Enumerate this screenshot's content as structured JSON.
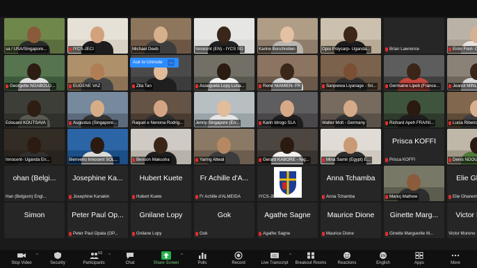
{
  "tiles": [
    {
      "name": "sa / USA/Singapore...",
      "muted": false,
      "kind": "video",
      "bg": "#5b6f3e",
      "skin": "#8a5b3a",
      "shirt": "#2a2a2a",
      "wall": "#7f9b55"
    },
    {
      "name": "IYCS-JECI",
      "muted": true,
      "kind": "video",
      "bg": "#d8d2c6",
      "skin": "#d2a27c",
      "shirt": "#1d1d1d",
      "wall": "#f0ece4"
    },
    {
      "name": "Michael Deeb",
      "muted": false,
      "kind": "video",
      "bg": "#6d5744",
      "skin": "#d4b08d",
      "shirt": "#3d3d3d",
      "wall": "#a8906f"
    },
    {
      "name": "Innocent (EN) - IYCS SG",
      "muted": false,
      "kind": "video",
      "active": true,
      "bg": "#d9d9d7",
      "skin": "#3a2618",
      "shirt": "#222",
      "wall": "#f0f0ee"
    },
    {
      "name": "Karine Bonchretien",
      "muted": false,
      "kind": "video",
      "bg": "#8e7d6a",
      "skin": "#e3c1a2",
      "shirt": "#b9b6b0",
      "wall": "#cbb89c"
    },
    {
      "name": "Opio Polycarp- Uganda...",
      "muted": false,
      "kind": "video",
      "bg": "#b8aa94",
      "skin": "#3b2618",
      "shirt": "#1c1c1c",
      "wall": "#dcd2c2"
    },
    {
      "name": "Brian Lawrence",
      "muted": true,
      "kind": "name",
      "big": ""
    },
    {
      "name": "Eirini Freri- Greece",
      "muted": true,
      "kind": "video",
      "bg": "#a99f93",
      "skin": "#d8b193",
      "shirt": "#e7e2dc",
      "wall": "#c9c1b6"
    },
    {
      "name": "Georgette NGABOLO...",
      "muted": true,
      "kind": "video",
      "bg": "#3d5a3a",
      "skin": "#2d1c12",
      "shirt": "#e0e0e0",
      "wall": "#6b8a5e"
    },
    {
      "name": "EUGENE VAZ",
      "muted": true,
      "kind": "video",
      "bg": "#8c7356",
      "skin": "#b07d55",
      "shirt": "#444",
      "wall": "#caa77c"
    },
    {
      "name": "Zita Tan",
      "muted": true,
      "kind": "video",
      "bg": "#3c3c3c",
      "skin": "#e0bb9a",
      "shirt": "#1f1f1f",
      "wall": "#555"
    },
    {
      "name": "Asseguela Lopy Luna...",
      "muted": true,
      "kind": "video",
      "bg": "#59584f",
      "skin": "#2b1c12",
      "shirt": "#f2f2f2",
      "wall": "#87857a"
    },
    {
      "name": "René NIAMIEN- FR",
      "muted": true,
      "kind": "video",
      "bg": "#6a5848",
      "skin": "#3b2719",
      "shirt": "#d7d7d7",
      "wall": "#a58c75"
    },
    {
      "name": "Sanjeewa Liyanage - Sri...",
      "muted": true,
      "kind": "video",
      "bg": "#5d4b3b",
      "skin": "#7a4f34",
      "shirt": "#2f2f2f",
      "wall": "#94775b"
    },
    {
      "name": "Germaine Lipeb (France...",
      "muted": true,
      "kind": "video",
      "bg": "#3f3f3f",
      "skin": "#3a2518",
      "shirt": "#c4463d",
      "wall": "#777"
    },
    {
      "name": "Jeanot MINLA M...",
      "muted": true,
      "kind": "video",
      "bg": "#6e665d",
      "skin": "#3a2518",
      "shirt": "#d9d9d9",
      "wall": "#a3998d"
    },
    {
      "name": "Edouard KOUTSAVA",
      "muted": false,
      "kind": "video",
      "bg": "#30302c",
      "skin": "#2d1d12",
      "shirt": "#5a5a52",
      "wall": "#4a4a44"
    },
    {
      "name": "Augustus (Singapore...",
      "muted": true,
      "kind": "video",
      "bg": "#5c6b7c",
      "skin": "#d7ad88",
      "shirt": "#333",
      "wall": "#8da2b8"
    },
    {
      "name": "Raquel e Nenona Rodrig...",
      "muted": false,
      "kind": "video",
      "bg": "#4a3c32",
      "skin": "#d4a585",
      "shirt": "#2c2c2c",
      "wall": "#7c6756"
    },
    {
      "name": "Jenny-Singapore (En...",
      "muted": false,
      "kind": "video",
      "bg": "#9aa4a8",
      "skin": "#e1bd9c",
      "shirt": "#e5e5e5",
      "wall": "#cfd6d8"
    },
    {
      "name": "Karin Idrogo SLA",
      "muted": true,
      "kind": "video",
      "bg": "#49474a",
      "skin": "#d6a885",
      "shirt": "#1d1d1d",
      "wall": "#707073"
    },
    {
      "name": "Walter Molt - Germany",
      "muted": false,
      "kind": "video",
      "bg": "#5a5148",
      "skin": "#d5aa88",
      "shirt": "#303030",
      "wall": "#8e8171"
    },
    {
      "name": "Richard Apeh FRA/NI...",
      "muted": true,
      "kind": "video",
      "bg": "#2d3a2c",
      "skin": "#2a1a10",
      "shirt": "#1d1d1d",
      "wall": "#4f6a4a"
    },
    {
      "name": "Lucia Ribeiro de...",
      "muted": true,
      "kind": "video",
      "bg": "#5e4b38",
      "skin": "#d9b08e",
      "shirt": "#3d3d3d",
      "wall": "#9d7f60"
    },
    {
      "name": "Innocent- Uganda En...",
      "muted": false,
      "kind": "video",
      "bg": "#29231e",
      "skin": "#2b1b11",
      "shirt": "#2f2f2f",
      "wall": "#3d342c"
    },
    {
      "name": "Bienvenu Innocent SOL...",
      "muted": false,
      "kind": "video",
      "bg": "#1b4f87",
      "skin": "#2a1a10",
      "shirt": "#d9d9d9",
      "wall": "#3a78c0"
    },
    {
      "name": "Benson Makusha",
      "muted": true,
      "kind": "video",
      "bg": "#b7b2aa",
      "skin": "#3a2517",
      "shirt": "#1d1d1d",
      "wall": "#e4e0d9"
    },
    {
      "name": "Yaring Altwal",
      "muted": true,
      "kind": "video",
      "bg": "#6c5d4e",
      "skin": "#b58863",
      "shirt": "#3c3c3c",
      "wall": "#a38f78"
    },
    {
      "name": "Gerard KABORE - Nig...",
      "muted": true,
      "kind": "video",
      "bg": "#3a3430",
      "skin": "#2a1a10",
      "shirt": "#f0f0f0",
      "wall": "#5c534c"
    },
    {
      "name": "Mina Samir (Egypt) E...",
      "muted": true,
      "kind": "video",
      "bg": "#cfc9c0",
      "skin": "#c99a75",
      "shirt": "#2c2c2c",
      "wall": "#efebe5"
    },
    {
      "name": "Prisca KOFFI",
      "muted": true,
      "kind": "name",
      "big": "Prisca KOFFI"
    },
    {
      "name": "Denis NDOUR FR...",
      "muted": true,
      "kind": "video",
      "bg": "#a09886",
      "skin": "#2a1a10",
      "shirt": "#4f7a3a",
      "wall": "#d8d2c3"
    },
    {
      "name": "Han (Belgium) Engl...",
      "muted": false,
      "kind": "name",
      "big": "ohan (Belgi..."
    },
    {
      "name": "Josephine Kanakin",
      "muted": true,
      "kind": "name",
      "big": "Josephine Ka..."
    },
    {
      "name": "Hubert Kuete",
      "muted": true,
      "kind": "name",
      "big": "Hubert Kuete"
    },
    {
      "name": "Fr Achille d'ALMEIDA",
      "muted": true,
      "kind": "name",
      "big": "Fr Achille d'A..."
    },
    {
      "name": "IYCS-JECI",
      "muted": false,
      "kind": "logo",
      "big": ""
    },
    {
      "name": "Anna Tchamba",
      "muted": true,
      "kind": "name",
      "big": "Anna Tchamba"
    },
    {
      "name": "Manoj Mathew",
      "muted": true,
      "kind": "video",
      "bg": "#5c5c4f",
      "skin": "#8a5c3c",
      "shirt": "#2d2d2d",
      "wall": "#8f8f7a"
    },
    {
      "name": "Elie Ghanem",
      "muted": true,
      "kind": "name",
      "big": "Elie Ghane..."
    },
    {
      "name": "",
      "muted": false,
      "kind": "name",
      "big": "Simon"
    },
    {
      "name": "Peter Paul Opata (OP...",
      "muted": true,
      "kind": "name",
      "big": "Peter Paul Op..."
    },
    {
      "name": "Gnilane Lopy",
      "muted": true,
      "kind": "name",
      "big": "Gnilane Lopy"
    },
    {
      "name": "Gok",
      "muted": true,
      "kind": "name",
      "big": "Gok"
    },
    {
      "name": "Agathe Sagne",
      "muted": true,
      "kind": "name",
      "big": "Agathe Sagne"
    },
    {
      "name": "Maurice Dione",
      "muted": true,
      "kind": "name",
      "big": "Maurice Dione"
    },
    {
      "name": "Ginette Marguerite M...",
      "muted": true,
      "kind": "name",
      "big": "Ginette Marg..."
    },
    {
      "name": "Victor Moreno",
      "muted": false,
      "kind": "name",
      "big": "Victor More..."
    }
  ],
  "overlay": {
    "unmute_label": "Ask to Unmute",
    "more_label": "..."
  },
  "toolbar": [
    {
      "id": "video",
      "label": "Stop Video",
      "icon": "video-camera-icon",
      "caret": true
    },
    {
      "id": "security",
      "label": "Security",
      "icon": "shield-icon",
      "caret": false
    },
    {
      "id": "participants",
      "label": "Participants",
      "icon": "participants-icon",
      "caret": true,
      "count": "53"
    },
    {
      "id": "chat",
      "label": "Chat",
      "icon": "chat-bubble-icon",
      "caret": false
    },
    {
      "id": "share",
      "label": "Share Screen",
      "icon": "share-screen-icon",
      "caret": true
    },
    {
      "id": "polls",
      "label": "Polls",
      "icon": "bar-chart-icon",
      "caret": false
    },
    {
      "id": "record",
      "label": "Record",
      "icon": "record-icon",
      "caret": false
    },
    {
      "id": "transcript",
      "label": "Live Transcript",
      "icon": "cc-icon",
      "caret": true
    },
    {
      "id": "breakout",
      "label": "Breakout Rooms",
      "icon": "grid-icon",
      "caret": false
    },
    {
      "id": "reactions",
      "label": "Reactions",
      "icon": "emoji-icon",
      "caret": false
    },
    {
      "id": "english",
      "label": "English",
      "icon": "interpretation-icon",
      "caret": false
    },
    {
      "id": "apps",
      "label": "Apps",
      "icon": "apps-icon",
      "caret": false
    },
    {
      "id": "more",
      "label": "More",
      "icon": "more-dots-icon",
      "caret": false
    }
  ],
  "colors": {
    "accent": "#22b14c",
    "mute": "#e02f2f",
    "highlight": "#2d8cff"
  }
}
